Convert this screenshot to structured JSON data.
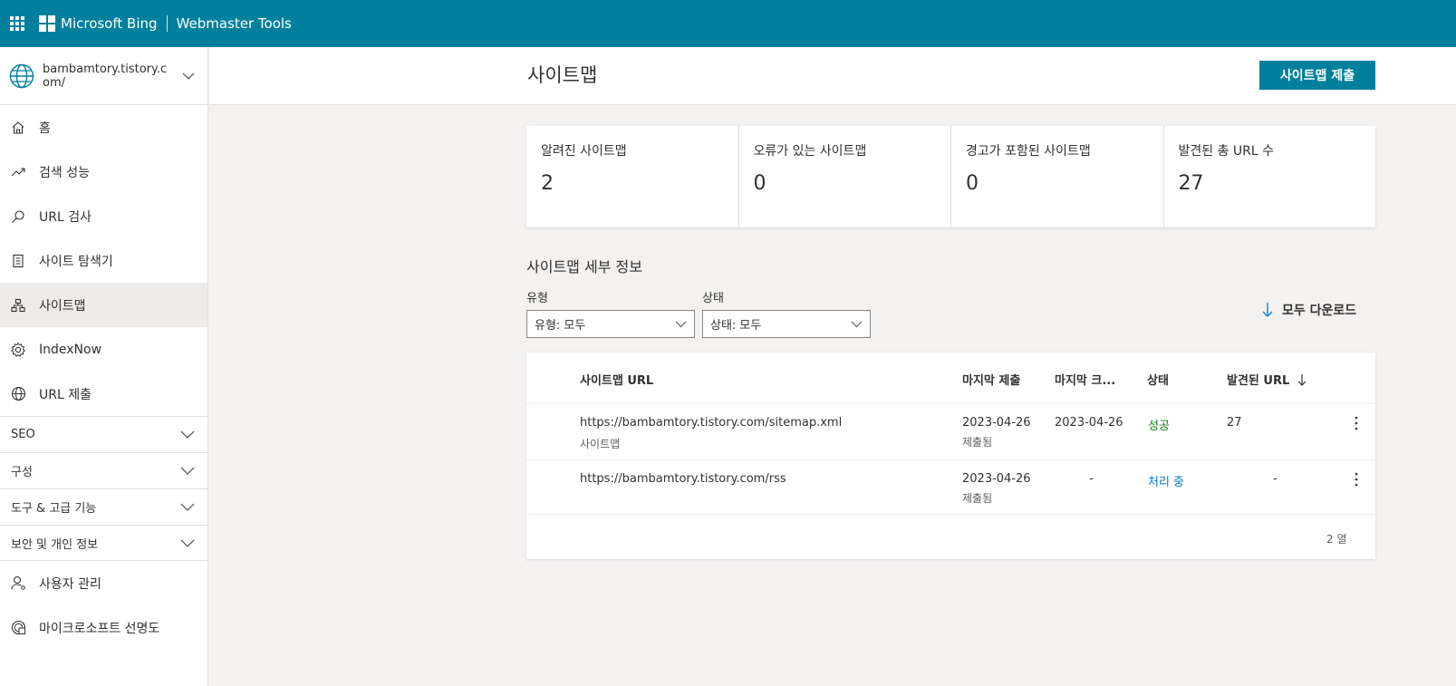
{
  "topbar": {
    "brand": "Microsoft Bing",
    "product": "Webmaster Tools",
    "bg_color": "#00809d"
  },
  "sidebar": {
    "site": "bambamtory.tistory.com/",
    "items": [
      {
        "label": "홈",
        "icon": "home-icon"
      },
      {
        "label": "검색 성능",
        "icon": "trending-up-icon"
      },
      {
        "label": "URL 검사",
        "icon": "search-icon"
      },
      {
        "label": "사이트 탐색기",
        "icon": "document-icon"
      },
      {
        "label": "사이트맵",
        "icon": "sitemap-icon",
        "active": true
      },
      {
        "label": "IndexNow",
        "icon": "gear-icon"
      },
      {
        "label": "URL 제출",
        "icon": "globe-icon"
      }
    ],
    "groups": [
      {
        "label": "SEO"
      },
      {
        "label": "구성"
      },
      {
        "label": "도구 & 고급 기능"
      },
      {
        "label": "보안 및 개인 정보"
      }
    ],
    "bottom_items": [
      {
        "label": "사용자 관리",
        "icon": "user-icon"
      },
      {
        "label": "마이크로소프트 선명도",
        "icon": "clarity-icon"
      }
    ]
  },
  "header": {
    "title": "사이트맵",
    "submit_label": "사이트맵 제출"
  },
  "stats": [
    {
      "label": "알려진 사이트맵",
      "value": "2"
    },
    {
      "label": "오류가 있는 사이트맵",
      "value": "0"
    },
    {
      "label": "경고가 포함된 사이트맵",
      "value": "0"
    },
    {
      "label": "발견된 총 URL 수",
      "value": "27"
    }
  ],
  "details": {
    "title": "사이트맵 세부 정보",
    "filters": {
      "type_label": "유형",
      "type_value": "유형: 모두",
      "status_label": "상태",
      "status_value": "상태: 모두"
    },
    "download_label": "모두 다운로드"
  },
  "table": {
    "columns": {
      "url": "사이트맵 URL",
      "last_submitted": "마지막 제출",
      "last_crawled": "마지막 크...",
      "status": "상태",
      "urls_found": "발견된 URL"
    },
    "rows": [
      {
        "url": "https://bambamtory.tistory.com/sitemap.xml",
        "type": "사이트맵",
        "last_submitted": "2023-04-26",
        "submitted_note": "제출됨",
        "last_crawled": "2023-04-26",
        "status": "성공",
        "urls_found": "27"
      },
      {
        "url": "https://bambamtory.tistory.com/rss",
        "type": "",
        "last_submitted": "2023-04-26",
        "submitted_note": "제출됨",
        "last_crawled": "-",
        "status": "처리 중",
        "urls_found": "-"
      }
    ],
    "row_count": "2 열"
  }
}
